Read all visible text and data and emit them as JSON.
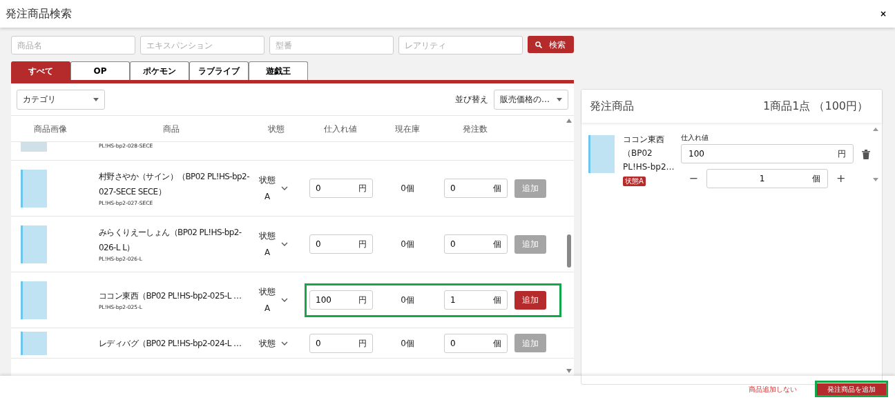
{
  "dialog": {
    "title": "発注商品検索",
    "close_label": "×"
  },
  "search": {
    "fields": [
      {
        "placeholder": "商品名"
      },
      {
        "placeholder": "エキスパンション"
      },
      {
        "placeholder": "型番"
      },
      {
        "placeholder": "レアリティ"
      }
    ],
    "button": "検索"
  },
  "tabs": [
    {
      "label": "すべて",
      "selected": true
    },
    {
      "label": "OP",
      "selected": false
    },
    {
      "label": "ポケモン",
      "selected": false
    },
    {
      "label": "ラブライブ",
      "selected": false
    },
    {
      "label": "遊戯王",
      "selected": false
    }
  ],
  "filters": {
    "category": "カテゴリ",
    "sort_label": "並び替え",
    "sort": "販売価格の…"
  },
  "table": {
    "columns": [
      "商品画像",
      "商品",
      "状態",
      "仕入れ値",
      "現在庫",
      "発注数"
    ],
    "rows": [
      {
        "kind": "partial",
        "code": "PL!HS-bp2-028-SECE"
      },
      {
        "kind": "full",
        "name": "村野さやか（サイン）（BP02 PL!HS-bp2-027-SECE SECE）",
        "code": "PL!HS-bp2-027-SECE",
        "state_label": "状態",
        "state_value": "A",
        "price": "0",
        "price_unit": "円",
        "stock": "0個",
        "quantity": "0",
        "quantity_unit": "個",
        "add_button": "追加",
        "enabled": false,
        "highlighted": false
      },
      {
        "kind": "full",
        "name": "みらくりえーしょん（BP02 PL!HS-bp2-026-L L）",
        "code": "PL!HS-bp2-026-L",
        "state_label": "状態",
        "state_value": "A",
        "price": "0",
        "price_unit": "円",
        "stock": "0個",
        "quantity": "0",
        "quantity_unit": "個",
        "add_button": "追加",
        "enabled": false,
        "highlighted": false
      },
      {
        "kind": "full",
        "name": "ココン東西（BP02 PL!HS-bp2-025-L …",
        "code": "PL!HS-bp2-025-L",
        "state_label": "状態",
        "state_value": "A",
        "price": "100",
        "price_unit": "円",
        "stock": "0個",
        "quantity": "1",
        "quantity_unit": "個",
        "add_button": "追加",
        "enabled": true,
        "highlighted": true
      },
      {
        "kind": "full",
        "name": "レディバグ（BP02 PL!HS-bp2-024-L …",
        "state_label": "状態",
        "price": "0",
        "price_unit": "円",
        "stock": "0個",
        "quantity": "0",
        "quantity_unit": "個",
        "add_button": "追加",
        "enabled": false,
        "highlighted": false
      }
    ]
  },
  "order_panel": {
    "title": "発注商品",
    "summary": "1商品1点 （100円）",
    "items": [
      {
        "name": "ココン東西（BP02 PL!HS-bp2…",
        "badge": "状態A",
        "price_label": "仕入れ値",
        "price": "100",
        "price_unit": "円",
        "minus": "−",
        "quantity": "1",
        "quantity_unit": "個",
        "plus": "+"
      }
    ]
  },
  "footer": {
    "cancel": "商品追加しない",
    "submit": "発注商品を追加",
    "submit_highlighted": true
  }
}
